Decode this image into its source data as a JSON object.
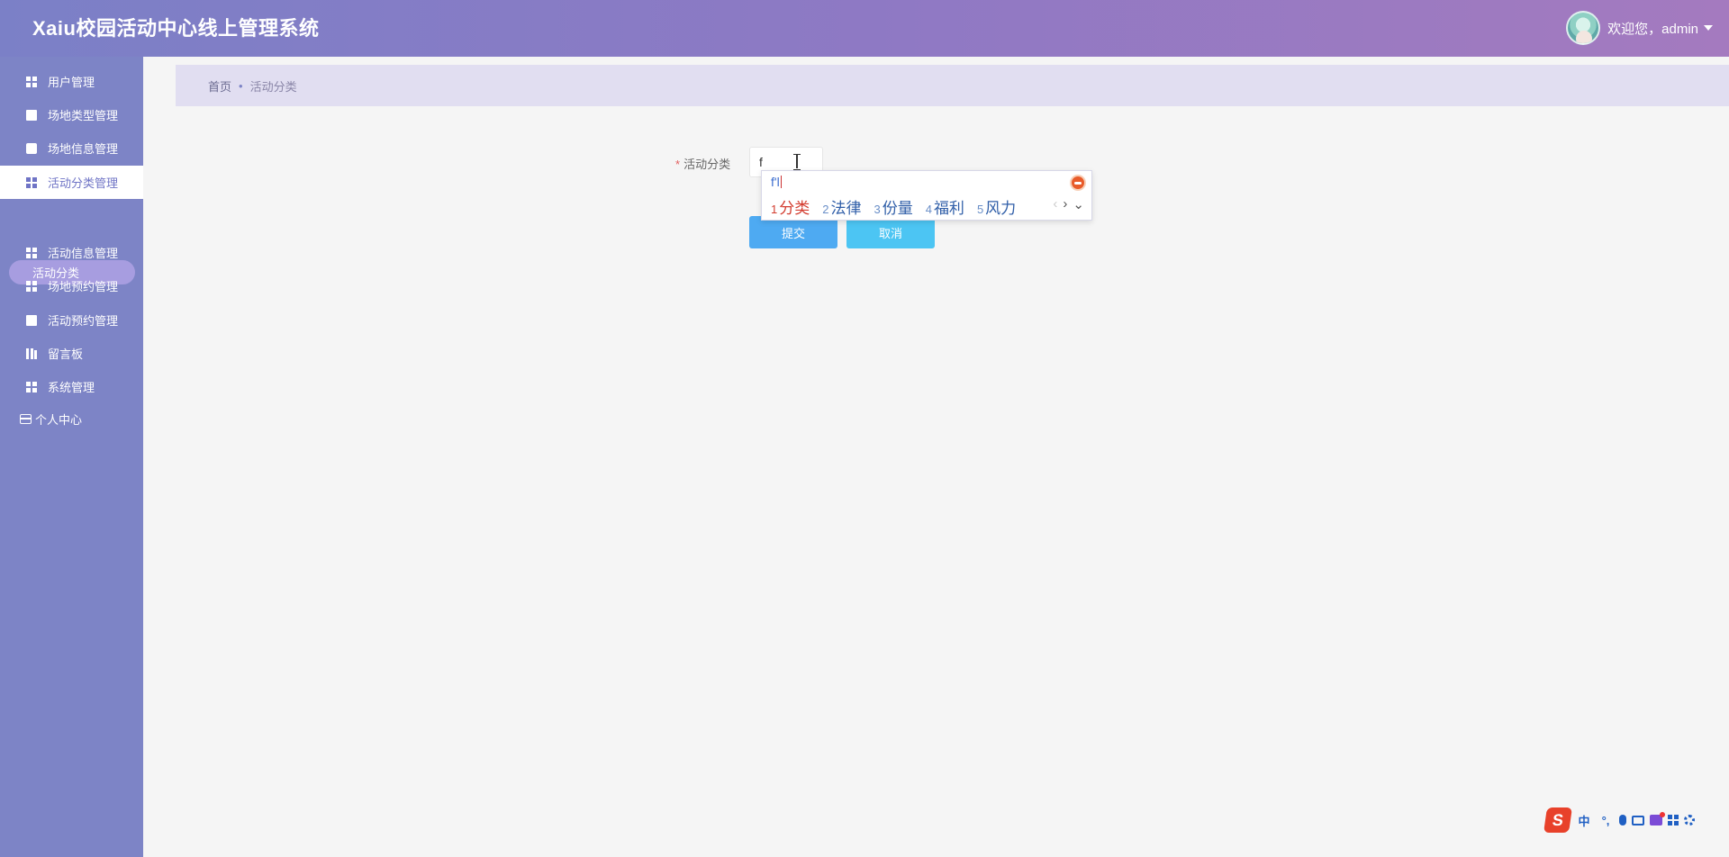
{
  "header": {
    "title": "Xaiu校园活动中心线上管理系统",
    "welcome": "欢迎您，admin"
  },
  "sidebar": {
    "items": [
      {
        "label": "用户管理",
        "icon": "grid-icon"
      },
      {
        "label": "场地类型管理",
        "icon": "clipboard-icon"
      },
      {
        "label": "场地信息管理",
        "icon": "chat-icon"
      },
      {
        "label": "活动分类管理",
        "icon": "grid-icon"
      },
      {
        "label": "活动信息管理",
        "icon": "grid-icon"
      },
      {
        "label": "场地预约管理",
        "icon": "grid-icon"
      },
      {
        "label": "活动预约管理",
        "icon": "clipboard-icon"
      },
      {
        "label": "留言板",
        "icon": "book-icon"
      },
      {
        "label": "系统管理",
        "icon": "grid-icon"
      }
    ],
    "sub_item": "活动分类",
    "personal_center": "个人中心"
  },
  "breadcrumb": {
    "home": "首页",
    "separator": "•",
    "current": "活动分类"
  },
  "form": {
    "label": "活动分类",
    "required_mark": "*",
    "input_value": "f",
    "submit": "提交",
    "cancel": "取消"
  },
  "ime": {
    "pinyin": "f'l",
    "candidates": [
      {
        "n": "1",
        "text": "分类"
      },
      {
        "n": "2",
        "text": "法律"
      },
      {
        "n": "3",
        "text": "份量"
      },
      {
        "n": "4",
        "text": "福利"
      },
      {
        "n": "5",
        "text": "风力"
      }
    ],
    "toolbar": {
      "logo": "S",
      "lang": "中",
      "punct": "°,"
    }
  },
  "colors": {
    "header_start": "#7b80c7",
    "header_end": "#a47abf",
    "sidebar": "#7d84c6",
    "active_text": "#6f74c6",
    "submit": "#4eaaf2",
    "cancel": "#4cc5f3"
  }
}
